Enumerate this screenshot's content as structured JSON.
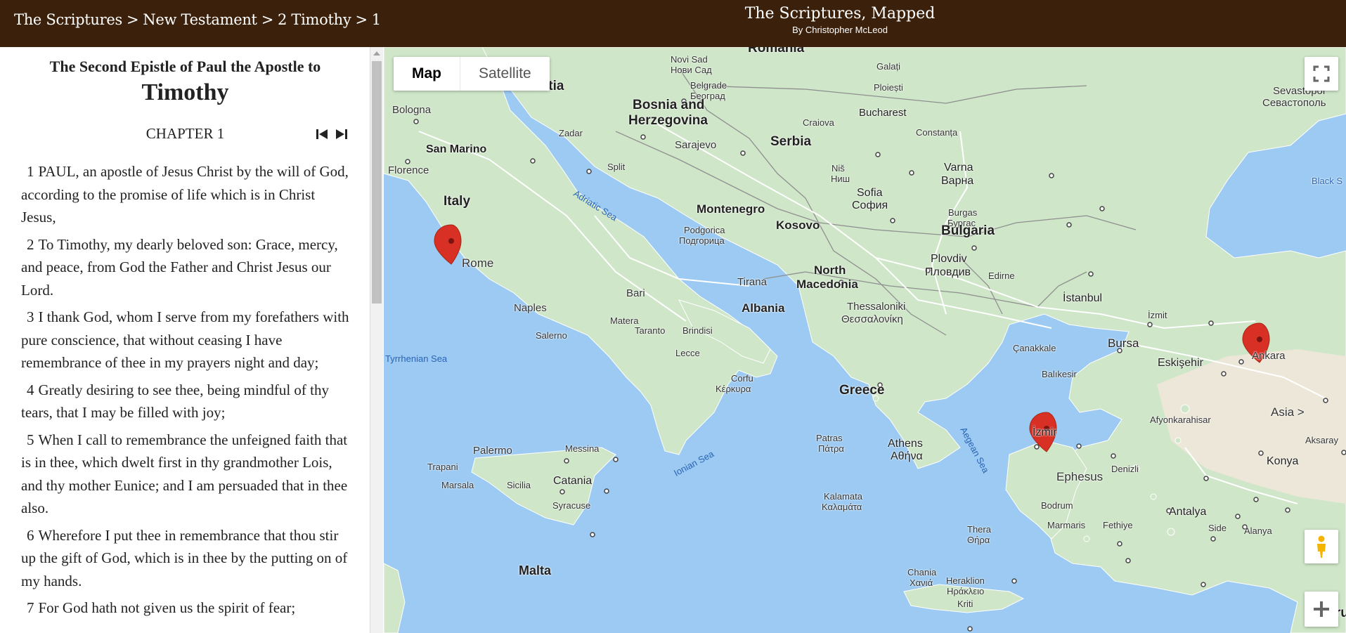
{
  "header": {
    "breadcrumbs": [
      "The Scriptures",
      "New Testament",
      "2 Timothy",
      "1"
    ],
    "separator": ">",
    "site_title": "The Scriptures, Mapped",
    "byline": "By Christopher McLeod"
  },
  "scripture": {
    "book_intro": "The Second Epistle of Paul the Apostle to",
    "book_title": "Timothy",
    "chapter_heading": "CHAPTER 1",
    "verses": [
      {
        "num": "1",
        "text": "PAUL, an apostle of Jesus Christ by the will of God, according to the promise of life which is in Christ Jesus,"
      },
      {
        "num": "2",
        "text": "To Timothy, my dearly beloved son: Grace, mercy, and peace, from God the Father and Christ Jesus our Lord."
      },
      {
        "num": "3",
        "text": "I thank God, whom I serve from my forefathers with pure conscience, that without ceasing I have remembrance of thee in my prayers night and day;"
      },
      {
        "num": "4",
        "text": "Greatly desiring to see thee, being mindful of thy tears, that I may be filled with joy;"
      },
      {
        "num": "5",
        "text": "When I call to remembrance the unfeigned faith that is in thee, which dwelt first in thy grandmother Lois, and thy mother Eunice; and I am persuaded that in thee also."
      },
      {
        "num": "6",
        "text": "Wherefore I put thee in remembrance that thou stir up the gift of God, which is in thee by the putting on of my hands."
      },
      {
        "num": "7",
        "text": "For God hath not given us the spirit of fear;"
      }
    ]
  },
  "map": {
    "type_buttons": {
      "map": "Map",
      "satellite": "Satellite"
    },
    "pins": {
      "rome": "Rome",
      "ephesus": "Ephesus",
      "asia": "Asia >"
    },
    "labels": {
      "romania": "Romania",
      "novi_sad": "Novi Sad",
      "novi_sad_cyr": "Нови Сад",
      "belgrade": "Belgrade",
      "belgrade_cyr": "Београд",
      "galati": "Galați",
      "ploiesti": "Ploiești",
      "bucharest": "Bucharest",
      "sevastopol": "Sevastopol",
      "sevastopol_cyr": "Севастополь",
      "croatia": "Croatia",
      "bologna": "Bologna",
      "bosnia": "Bosnia and",
      "herzegovina": "Herzegovina",
      "zadar": "Zadar",
      "craiova": "Craiova",
      "constanta": "Constanța",
      "serbia": "Serbia",
      "sarajevo": "Sarajevo",
      "san_marino": "San Marino",
      "split": "Split",
      "nis": "Niš",
      "nis_cyr": "Ниш",
      "varna": "Varna",
      "varna_cyr": "Варна",
      "black_sea": "Black S",
      "florence": "Florence",
      "adriatic_sea": "Adriatic Sea",
      "sofia": "Sofia",
      "sofia_cyr": "София",
      "italy": "Italy",
      "montenegro": "Montenegro",
      "burgas": "Burgas",
      "burgas_cyr": "Бургас",
      "kosovo": "Kosovo",
      "bulgaria": "Bulgaria",
      "podgorica": "Podgorica",
      "podgorica_cyr": "Подгорица",
      "plovdiv": "Plovdiv",
      "plovdiv_cyr": "Пловдив",
      "north": "North",
      "macedonia": "Macedonia",
      "tirana": "Tirana",
      "edirne": "Edirne",
      "bari": "Bari",
      "istanbul": "İstanbul",
      "albania": "Albania",
      "thessaloniki": "Thessaloniki",
      "thessaloniki_gr": "Θεσσαλονίκη",
      "naples": "Naples",
      "matera": "Matera",
      "izmit": "İzmit",
      "taranto": "Taranto",
      "brindisi": "Brindisi",
      "salerno": "Salerno",
      "canakkale": "Çanakkale",
      "bursa": "Bursa",
      "lecce": "Lecce",
      "ankara": "Ankara",
      "tyrrhenian_sea": "Tyrrhenian Sea",
      "eskisehir": "Eskişehir",
      "corfu": "Corfu",
      "corfu_gr": "Κέρκυρα",
      "balikesir": "Balıkesir",
      "greece": "Greece",
      "afyon": "Afyonkarahisar",
      "izmir": "İzmir",
      "palermo": "Palermo",
      "messina": "Messina",
      "patras": "Patras",
      "patras_gr": "Πάτρα",
      "athens": "Athens",
      "athens_gr": "Αθήνα",
      "aegean_sea": "Aegean Sea",
      "aksaray": "Aksaray",
      "trapani": "Trapani",
      "ionian_sea": "Ionian Sea",
      "denizli": "Denizli",
      "konya": "Konya",
      "catania": "Catania",
      "marsala": "Marsala",
      "sicilia": "Sicilia",
      "kalamata": "Kalamata",
      "kalamata_gr": "Καλαμάτα",
      "syracuse": "Syracuse",
      "bodrum": "Bodrum",
      "antalya": "Antalya",
      "marmaris": "Marmaris",
      "fethiye": "Fethiye",
      "side": "Side",
      "alanya": "Alanya",
      "thera": "Thera",
      "thera_gr": "Θήρα",
      "malta": "Malta",
      "chania": "Chania",
      "chania_gr": "Χανιά",
      "heraklion": "Heraklion",
      "heraklion_gr": "Ηράκλειο",
      "kriti": "Kriti",
      "cyprus": "Cypru"
    }
  },
  "colors": {
    "header_bg": "#3b210b",
    "sea": "#9ccaf2",
    "land": "#cfe6c8",
    "pin": "#d93025",
    "sea_label": "#2a64b6"
  }
}
